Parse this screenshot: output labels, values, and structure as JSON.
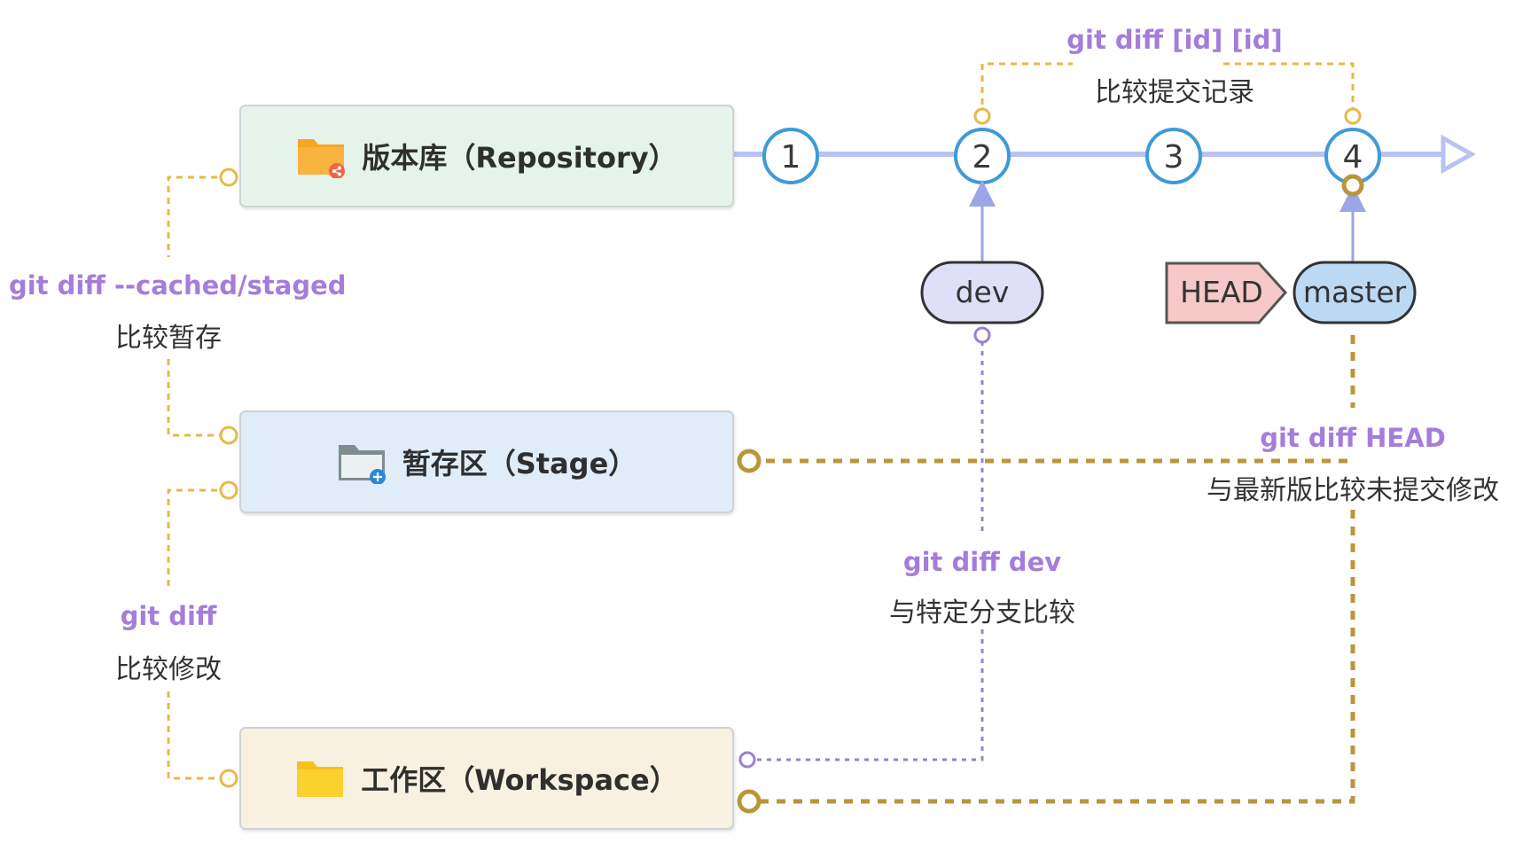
{
  "areas": {
    "repository": {
      "label": "版本库（Repository）",
      "icon": "share-folder-icon"
    },
    "stage": {
      "label": "暂存区（Stage）",
      "icon": "add-folder-icon"
    },
    "workspace": {
      "label": "工作区（Workspace）",
      "icon": "folder-icon"
    }
  },
  "commits": [
    "1",
    "2",
    "3",
    "4"
  ],
  "refs": {
    "dev": "dev",
    "head": "HEAD",
    "master": "master"
  },
  "annotations": {
    "commits_cmd": "git diff [id] [id]",
    "commits_desc": "比较提交记录",
    "cached_cmd": "git diff --cached/staged",
    "cached_desc": "比较暂存",
    "diff_cmd": "git diff",
    "diff_desc": "比较修改",
    "dev_cmd": "git diff dev",
    "dev_desc": "与特定分支比较",
    "head_cmd": "git diff HEAD",
    "head_desc": "与最新版比较未提交修改"
  },
  "colors": {
    "repository_bg": "#e5f3ea",
    "stage_bg": "#e0edf9",
    "workspace_bg": "#f8f1e2",
    "timeline": "#b9c3f0",
    "commit_ring": "#3f9ad8",
    "command_text": "#a47ddb",
    "dotted_yellow": "#e8b84a",
    "dotted_brown": "#b8963a",
    "dotted_purple": "#9a80d0",
    "head_fill": "#f6c8c8",
    "dev_fill": "#dfe0f7",
    "master_fill": "#bcd9f4"
  }
}
